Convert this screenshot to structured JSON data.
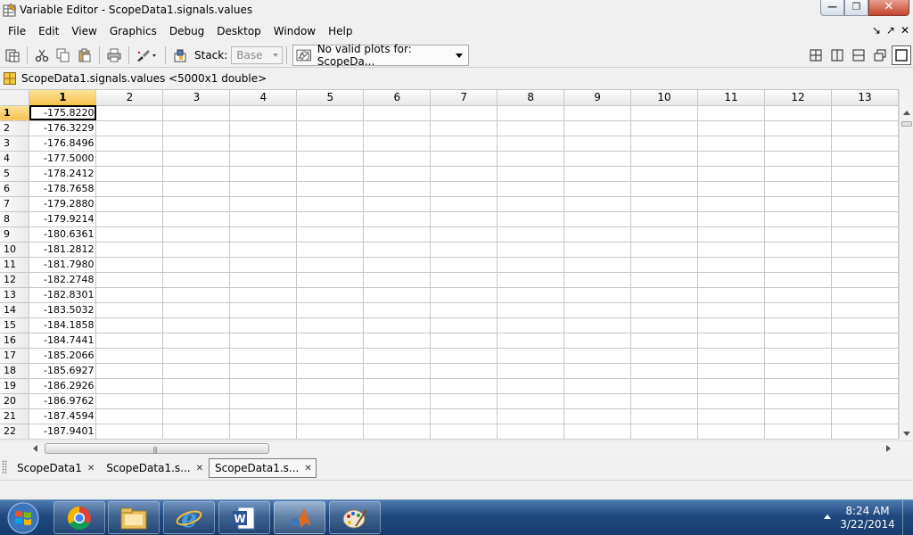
{
  "window": {
    "title": "Variable Editor - ScopeData1.signals.values"
  },
  "menu": {
    "items": [
      "File",
      "Edit",
      "View",
      "Graphics",
      "Debug",
      "Desktop",
      "Window",
      "Help"
    ]
  },
  "toolbar": {
    "stack_label": "Stack:",
    "stack_value": "Base",
    "plot_select": "No valid plots for: ScopeDa..."
  },
  "variable": {
    "header": "ScopeData1.signals.values <5000x1 double>"
  },
  "grid": {
    "columns": [
      "1",
      "2",
      "3",
      "4",
      "5",
      "6",
      "7",
      "8",
      "9",
      "10",
      "11",
      "12",
      "13"
    ],
    "rows": [
      {
        "label": "1",
        "value": "-175.8220"
      },
      {
        "label": "2",
        "value": "-176.3229"
      },
      {
        "label": "3",
        "value": "-176.8496"
      },
      {
        "label": "4",
        "value": "-177.5000"
      },
      {
        "label": "5",
        "value": "-178.2412"
      },
      {
        "label": "6",
        "value": "-178.7658"
      },
      {
        "label": "7",
        "value": "-179.2880"
      },
      {
        "label": "8",
        "value": "-179.9214"
      },
      {
        "label": "9",
        "value": "-180.6361"
      },
      {
        "label": "10",
        "value": "-181.2812"
      },
      {
        "label": "11",
        "value": "-181.7980"
      },
      {
        "label": "12",
        "value": "-182.2748"
      },
      {
        "label": "13",
        "value": "-182.8301"
      },
      {
        "label": "14",
        "value": "-183.5032"
      },
      {
        "label": "15",
        "value": "-184.1858"
      },
      {
        "label": "16",
        "value": "-184.7441"
      },
      {
        "label": "17",
        "value": "-185.2066"
      },
      {
        "label": "18",
        "value": "-185.6927"
      },
      {
        "label": "19",
        "value": "-186.2926"
      },
      {
        "label": "20",
        "value": "-186.9762"
      },
      {
        "label": "21",
        "value": "-187.4594"
      },
      {
        "label": "22",
        "value": "-187.9401"
      }
    ]
  },
  "tabs": [
    {
      "label": "ScopeData1",
      "active": false
    },
    {
      "label": "ScopeData1.s...",
      "active": false
    },
    {
      "label": "ScopeData1.s...",
      "active": true
    }
  ],
  "taskbar": {
    "apps": [
      "chrome-icon",
      "file-explorer-icon",
      "internet-explorer-icon",
      "word-icon",
      "matlab-icon",
      "paint-icon"
    ],
    "time": "8:24 AM",
    "date": "3/22/2014"
  },
  "colors": {
    "selection_header": "#f7c24c",
    "taskbar": "#1f4a80"
  }
}
